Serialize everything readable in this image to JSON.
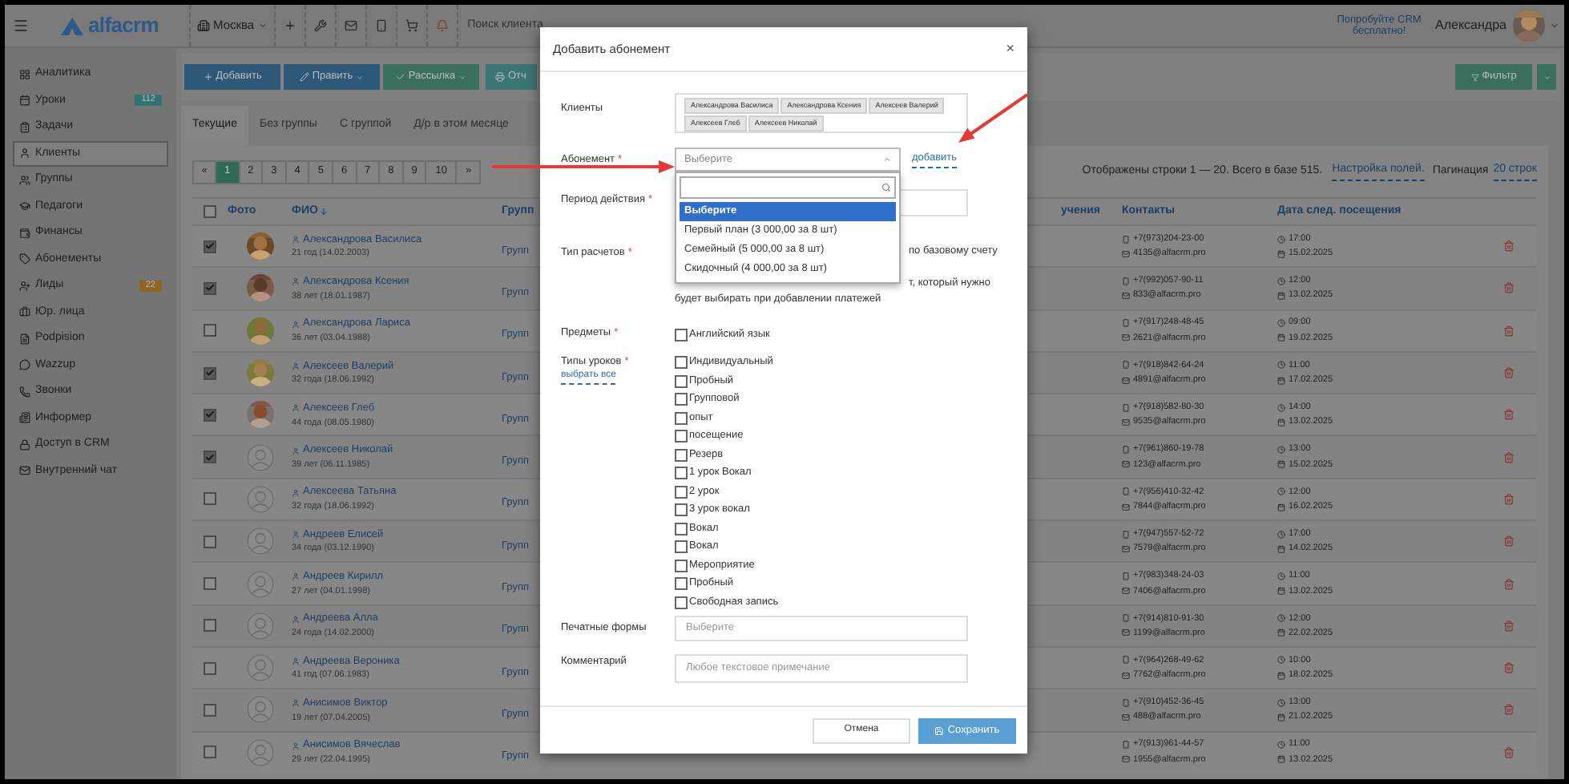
{
  "topbar": {
    "logo": "alfacrm",
    "branch": "Москва",
    "search_placeholder": "Поиск клиента",
    "promo": "Попробуйте CRM бесплатно!",
    "user": "Александра"
  },
  "sidebar": {
    "items": [
      {
        "label": "Аналитика",
        "selected": false
      },
      {
        "label": "Уроки",
        "selected": false,
        "badge": "112",
        "color": "#2f7472"
      },
      {
        "label": "Задачи",
        "selected": false
      },
      {
        "label": "Клиенты",
        "selected": true
      },
      {
        "label": "Группы",
        "selected": false
      },
      {
        "label": "Педагоги",
        "selected": false
      },
      {
        "label": "Финансы",
        "selected": false
      },
      {
        "label": "Абонементы",
        "selected": false
      },
      {
        "label": "Лиды",
        "selected": false,
        "badge": "22",
        "color": "#8f6424"
      },
      {
        "label": "Юр. лица",
        "selected": false
      },
      {
        "label": "Podpision",
        "selected": false
      },
      {
        "label": "Wazzup",
        "selected": false
      },
      {
        "label": "Звонки",
        "selected": false
      },
      {
        "label": "Информер",
        "selected": false
      },
      {
        "label": "Доступ в CRM",
        "selected": false
      },
      {
        "label": "Внутренний чат",
        "selected": false
      }
    ]
  },
  "toolbar": {
    "buttons": [
      {
        "label": "Добавить",
        "color": "#2d5878",
        "dropdown": false
      },
      {
        "label": "Править",
        "color": "#2d5878",
        "dropdown": true
      },
      {
        "label": "Рассылка",
        "color": "#3a6f5c",
        "dropdown": true
      },
      {
        "label": "Отч",
        "color": "#3b7575",
        "dropdown": false
      }
    ],
    "filter": "Фильтр"
  },
  "tabs": [
    {
      "label": "Текущие",
      "selected": true
    },
    {
      "label": "Без группы",
      "selected": false
    },
    {
      "label": "С группой",
      "selected": false
    },
    {
      "label": "Д/р в этом месяце",
      "selected": false
    }
  ],
  "pagination": {
    "prev": "«",
    "next": "»",
    "pages": [
      {
        "label": "1",
        "selected": true
      },
      {
        "label": "2",
        "selected": false
      },
      {
        "label": "3",
        "selected": false
      },
      {
        "label": "4",
        "selected": false
      },
      {
        "label": "5",
        "selected": false
      },
      {
        "label": "6",
        "selected": false
      },
      {
        "label": "7",
        "selected": false
      },
      {
        "label": "8",
        "selected": false
      },
      {
        "label": "9",
        "selected": false
      },
      {
        "label": "10",
        "selected": false
      }
    ]
  },
  "summary": {
    "text": "Отображены строки 1 — 20. Всего в базе 515.",
    "fields_link": "Настройка полей.",
    "pagination_label": "Пагинация",
    "pagination_link": "20 строк"
  },
  "table": {
    "select_all_checked": false,
    "columns": [
      {
        "label": "Фото",
        "sorted": false
      },
      {
        "label": "ФИО",
        "sorted": true
      },
      {
        "label": "Групп",
        "sorted": false
      },
      {
        "label": "учения",
        "sorted": false
      },
      {
        "label": "Контакты",
        "sorted": false
      },
      {
        "label": "Дата след. посещения",
        "sorted": false
      }
    ],
    "rows": [
      {
        "checked": true,
        "name": "Александрова Василиса",
        "age": "21 год (14.02.2003)",
        "group": "Групп",
        "phone": "+7(973)204-23-00",
        "email": "4135@alfacrm.pro",
        "time": "17:00",
        "date": "15.02.2025"
      },
      {
        "checked": true,
        "name": "Александрова Ксения",
        "age": "38 лет (18.01.1987)",
        "group": "Групп",
        "phone": "+7(992)057-90-11",
        "email": "833@alfacrm.pro",
        "time": "12:00",
        "date": "13.02.2025"
      },
      {
        "checked": false,
        "name": "Александрова Лариса",
        "age": "36 лет (03.04.1988)",
        "group": "Групп",
        "phone": "+7(917)248-48-45",
        "email": "2621@alfacrm.pro",
        "time": "09:00",
        "date": "19.02.2025"
      },
      {
        "checked": true,
        "name": "Алексеев Валерий",
        "age": "32 года (18.06.1992)",
        "group": "Групп",
        "phone": "+7(918)842-64-24",
        "email": "4891@alfacrm.pro",
        "time": "11:00",
        "date": "17.02.2025"
      },
      {
        "checked": true,
        "name": "Алексеев Глеб",
        "age": "44 года (08.05.1980)",
        "group": "Групп",
        "phone": "+7(918)582-80-30",
        "email": "9535@alfacrm.pro",
        "time": "14:00",
        "date": "13.02.2025"
      },
      {
        "checked": true,
        "kind": "placeholder",
        "name": "Алексеев Николай",
        "age": "39 лет (06.11.1985)",
        "group": "Групп",
        "phone": "+7(961)860-19-78",
        "email": "123@alfacrm.pro",
        "time": "13:00",
        "date": "15.02.2025"
      },
      {
        "checked": false,
        "kind": "placeholder",
        "name": "Алексеева Татьяна",
        "age": "32 года (18.06.1992)",
        "group": "Групп",
        "phone": "+7(956)410-32-42",
        "email": "7844@alfacrm.pro",
        "time": "12:00",
        "date": "16.02.2025"
      },
      {
        "checked": false,
        "kind": "placeholder",
        "name": "Андреев Елисей",
        "age": "34 года (03.12.1990)",
        "group": "Групп",
        "phone": "+7(947)557-52-72",
        "email": "7579@alfacrm.pro",
        "time": "17:00",
        "date": "14.02.2025"
      },
      {
        "checked": false,
        "kind": "placeholder",
        "name": "Андреев Кирилл",
        "age": "27 лет (04.01.1998)",
        "group": "Групп",
        "phone": "+7(983)348-24-03",
        "email": "7406@alfacrm.pro",
        "time": "11:00",
        "date": "13.02.2025"
      },
      {
        "checked": false,
        "kind": "placeholder",
        "name": "Андреева Алла",
        "age": "24 года (14.02.2000)",
        "group": "Групп",
        "phone": "+7(914)810-91-30",
        "email": "1199@alfacrm.pro",
        "time": "12:00",
        "date": "22.02.2025"
      },
      {
        "checked": false,
        "kind": "placeholder",
        "name": "Андреева Вероника",
        "age": "41 год (07.06.1983)",
        "group": "Групп",
        "phone": "+7(964)268-49-62",
        "email": "7762@alfacrm.pro",
        "time": "10:00",
        "date": "18.02.2025"
      },
      {
        "checked": false,
        "kind": "placeholder",
        "name": "Анисимов Виктор",
        "age": "19 лет (07.04.2005)",
        "group": "Групп",
        "phone": "+7(910)452-36-45",
        "email": "488@alfacrm.pro",
        "time": "13:00",
        "date": "21.02.2025"
      },
      {
        "checked": false,
        "kind": "placeholder",
        "name": "Анисимов Вячеслав",
        "age": "29 лет (22.04.1995)",
        "group": "Групп",
        "phone": "+7(913)961-44-57",
        "email": "1955@alfacrm.pro",
        "time": "11:00",
        "date": "13.02.2025"
      }
    ]
  },
  "modal": {
    "title": "Добавить абонемент",
    "close": "×",
    "clients": {
      "label": "Клиенты",
      "tags": [
        "Александрова Василиса",
        "Александрова Ксения",
        "Алексеев Валерий",
        "Алексеев Глеб",
        "Алексеев Николай"
      ]
    },
    "subscription": {
      "label": "Абонемент",
      "required": "*",
      "value": "Выберите",
      "add_link": "добавить",
      "options": [
        {
          "label": "Выберите",
          "selected": true
        },
        {
          "label": "Первый план (3 000,00 за 8 шт)",
          "selected": false
        },
        {
          "label": "Семейный (5 000,00 за 8 шт)",
          "selected": false
        },
        {
          "label": "Скидочный (4 000,00 за 8 шт)",
          "selected": false
        }
      ]
    },
    "period": {
      "label": "Период действия",
      "required": "*"
    },
    "payment_type": {
      "label": "Тип расчетов",
      "required": "*",
      "lines": [
        "по базовому счету",
        "т, который нужно",
        "будет выбирать при добавлении платежей"
      ]
    },
    "subjects": {
      "label": "Предметы",
      "required": "*",
      "items": [
        {
          "label": "Английский язык",
          "checked": false
        }
      ]
    },
    "lesson_types": {
      "label": "Типы уроков",
      "required": "*",
      "select_all": "выбрать все",
      "items": [
        {
          "label": "Индивидуальный",
          "checked": false
        },
        {
          "label": "Пробный",
          "checked": false
        },
        {
          "label": "Групповой",
          "checked": false
        },
        {
          "label": "опыт",
          "checked": false
        },
        {
          "label": "посещение",
          "checked": false
        },
        {
          "label": "Резерв",
          "checked": false
        },
        {
          "label": "1 урок Вокал",
          "checked": false
        },
        {
          "label": "2 урок",
          "checked": false
        },
        {
          "label": "3 урок вокал",
          "checked": false
        },
        {
          "label": "Вокал",
          "checked": false
        },
        {
          "label": "Вокал",
          "checked": false
        },
        {
          "label": "Мероприятие",
          "checked": false
        },
        {
          "label": "Пробный",
          "checked": false
        },
        {
          "label": "Свободная запись",
          "checked": false
        }
      ]
    },
    "print_forms": {
      "label": "Печатные формы",
      "placeholder": "Выберите"
    },
    "comment": {
      "label": "Комментарий",
      "placeholder": "Любое текстовое примечание"
    },
    "cancel": "Отмена",
    "save": "Сохранить"
  }
}
